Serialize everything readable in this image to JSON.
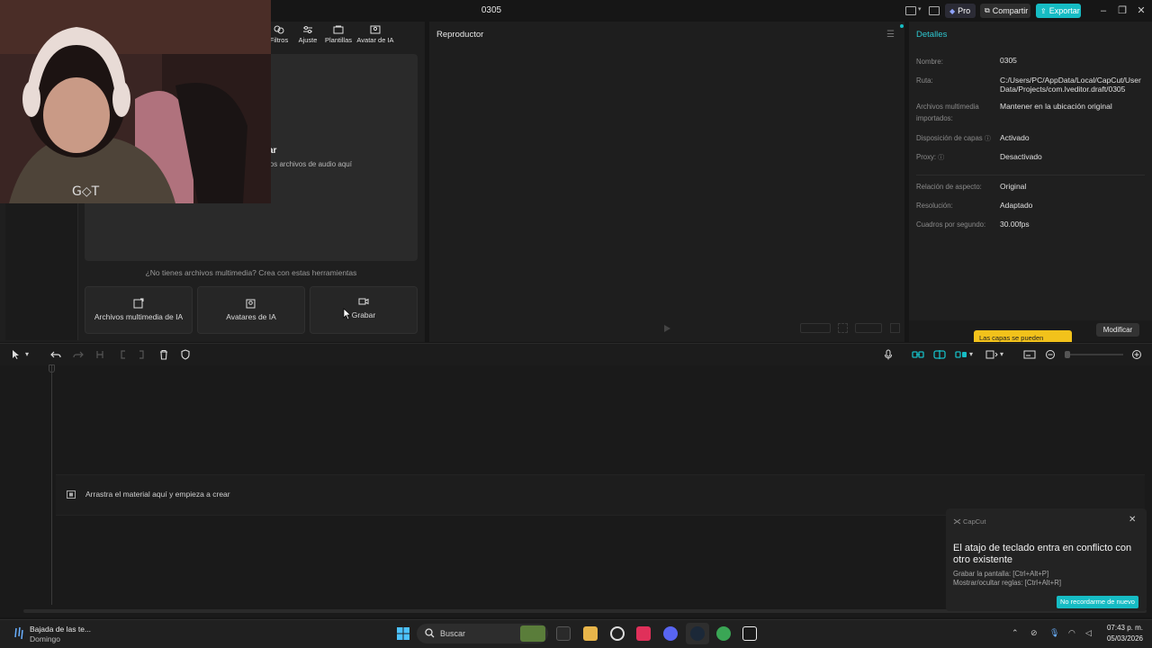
{
  "window": {
    "title": "0305"
  },
  "titlebar": {
    "pro": "Pro",
    "share": "Compartir",
    "export": "Exportar"
  },
  "media_panel": {
    "tabs": [
      {
        "label": "Filtros",
        "icon": "filters-icon"
      },
      {
        "label": "Ajuste",
        "icon": "adjust-icon"
      },
      {
        "label": "Plantillas",
        "icon": "templates-icon"
      },
      {
        "label": "Avatar de IA",
        "icon": "ai-avatar-icon"
      }
    ],
    "drop_title": "ar",
    "drop_subtitle": "los archivos de audio aquí",
    "no_media_text": "¿No tienes archivos multimedia? Crea con estas herramientas",
    "tools": [
      {
        "label": "Archivos multimedia de IA",
        "icon": "ai-media-icon"
      },
      {
        "label": "Avatares de IA",
        "icon": "ai-avatar-icon"
      },
      {
        "label": "Grabar",
        "icon": "camera-icon"
      }
    ]
  },
  "player": {
    "title": "Reproductor"
  },
  "details": {
    "title": "Detalles",
    "rows": [
      {
        "label": "Nombre:",
        "value": "0305"
      },
      {
        "label": "Ruta:",
        "value": "C:/Users/PC/AppData/Local/CapCut/User Data/Projects/com.lveditor.draft/0305"
      },
      {
        "label": "Archivos multimedia importados:",
        "value": "Mantener en la ubicación original"
      },
      {
        "label": "Disposición de capas",
        "value": "Activado"
      },
      {
        "label": "Proxy:",
        "value": "Desactivado"
      },
      {
        "label": "Relación de aspecto:",
        "value": "Original"
      },
      {
        "label": "Resolución:",
        "value": "Adaptado"
      },
      {
        "label": "Cuadros por segundo:",
        "value": "30.00fps"
      }
    ],
    "layers_tip": "Las capas se pueden",
    "modify_button": "Modificar"
  },
  "timeline": {
    "drop_text": "Arrastra el material aquí y empieza a crear"
  },
  "notification": {
    "app": "CapCut",
    "title": "El atajo de teclado entra en conflicto con otro existente",
    "lines": [
      "Grabar la pantalla: [Ctrl+Alt+P]",
      "Mostrar/ocultar reglas: [Ctrl+Alt+R]"
    ],
    "button": "No recordarme de nuevo"
  },
  "taskbar": {
    "weather_title": "Bajada de las te...",
    "weather_sub": "Domingo",
    "search_placeholder": "Buscar",
    "time": "07:43 p. m.",
    "date": "05/03/2026"
  },
  "colors": {
    "accent": "#16bcc4",
    "tip": "#f2c21b"
  }
}
